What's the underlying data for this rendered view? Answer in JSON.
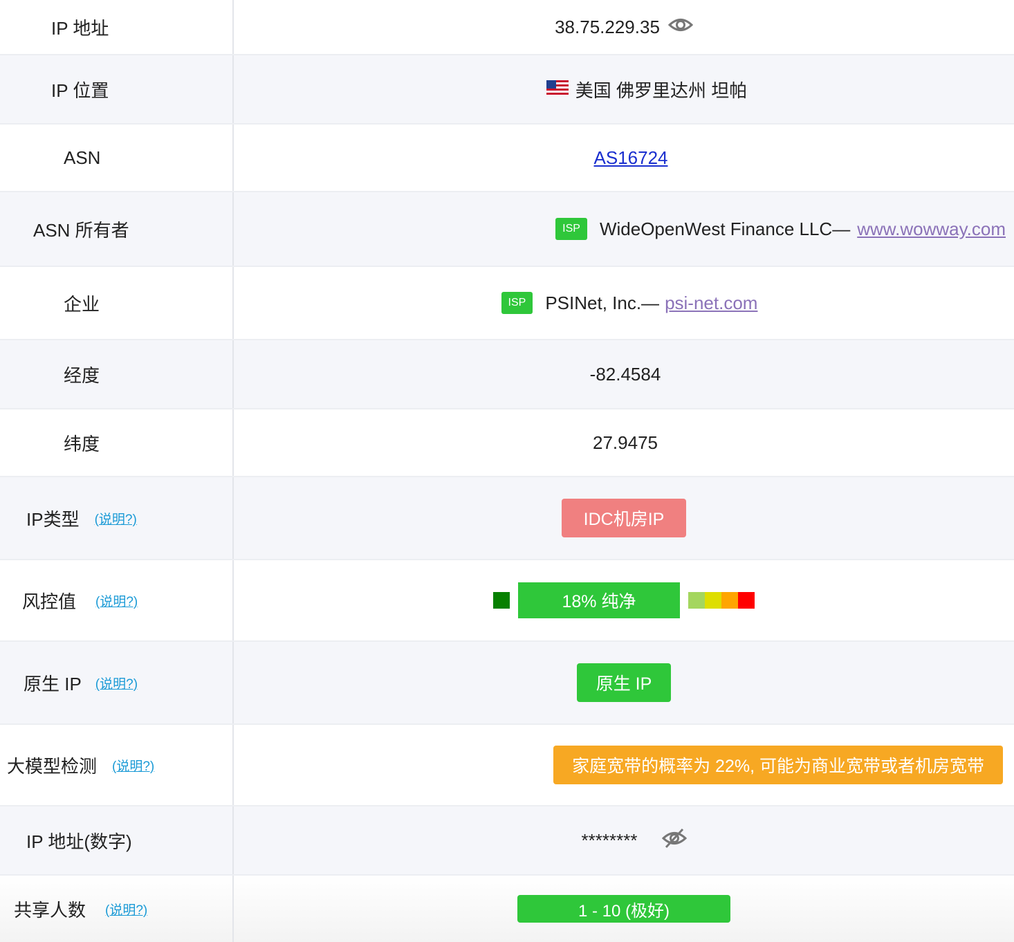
{
  "rows": {
    "ip_address": {
      "label": "IP 地址",
      "value": "38.75.229.35"
    },
    "ip_location": {
      "label": "IP 位置",
      "flag": "🇺🇸",
      "value": "美国 佛罗里达州 坦帕"
    },
    "asn": {
      "label": "ASN",
      "value": "AS16724"
    },
    "asn_owner": {
      "label": "ASN 所有者",
      "badge": "ISP",
      "name": "WideOpenWest Finance LLC—",
      "link": "www.wowway.com"
    },
    "enterprise": {
      "label": "企业",
      "badge": "ISP",
      "name": "PSINet, Inc.—",
      "link": "psi-net.com"
    },
    "longitude": {
      "label": "经度",
      "value": "-82.4584"
    },
    "latitude": {
      "label": "纬度",
      "value": "27.9475"
    },
    "ip_type": {
      "label": "IP类型",
      "help": "(说明?)",
      "value": "IDC机房IP",
      "color": "#f08080"
    },
    "risk": {
      "label": "风控值",
      "help": "(说明?)",
      "value": "18%  纯净",
      "percent": 18,
      "colors": [
        "#078000",
        "#2fc73a",
        "#a4d65e",
        "#dede00",
        "#ffa500",
        "#ff0000"
      ]
    },
    "native_ip": {
      "label": "原生 IP",
      "help": "(说明?)",
      "value": "原生 IP"
    },
    "llm_detect": {
      "label": "大模型检测",
      "help": "(说明?)",
      "value": "家庭宽带的概率为 22%, 可能为商业宽带或者机房宽带",
      "color": "#f7a823"
    },
    "ip_numeric": {
      "label": "IP 地址(数字)",
      "value": "********"
    },
    "shared_users": {
      "label": "共享人数",
      "help": "(说明?)",
      "value": "1 - 10 (极好)"
    }
  },
  "icons": {
    "eye": "eye-icon",
    "eye_off": "eye-off-icon"
  }
}
